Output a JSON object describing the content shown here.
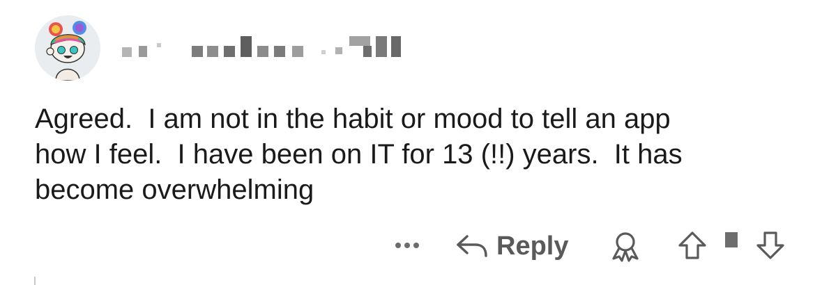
{
  "comment": {
    "username": "",
    "body": "Agreed.  I am not in the habit or mood to tell an app\nhow I feel.  I have been on IT for 13 (!!) years.  It has\nbecome overwhelming",
    "avatar_icon": "snoo-avatar-rainbow-hair"
  },
  "actions": {
    "more_icon": "ellipsis-icon",
    "reply_icon": "reply-arrow-icon",
    "reply_label": "Reply",
    "award_icon": "award-ribbon-icon",
    "upvote_icon": "upvote-arrow-icon",
    "downvote_icon": "downvote-arrow-icon"
  },
  "colors": {
    "text": "#1a1a1b",
    "icon_gray": "#5a5a5a",
    "background": "#ffffff"
  }
}
